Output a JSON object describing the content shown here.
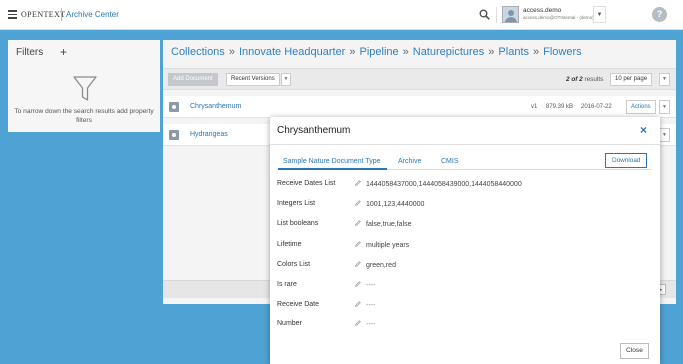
{
  "header": {
    "brand": "OPENTEXT",
    "app_name": "Archive Center",
    "user_name": "access.demo",
    "user_email": "access.demo@OTInternal - (demo)",
    "help_label": "?"
  },
  "filters": {
    "title": "Filters",
    "add_label": "+",
    "message": "To narrow down the search results add property filters"
  },
  "breadcrumb": [
    "Collections",
    "Innovate Headquarter",
    "Pipeline",
    "Naturepictures",
    "Plants",
    "Flowers"
  ],
  "breadcrumb_separator": "»",
  "toolbar": {
    "add_document": "Add Document",
    "recent_versions": "Recent Versions",
    "results_count": "2 of 2",
    "results_suffix": " results",
    "per_page": "10 per page"
  },
  "documents": [
    {
      "name": "Chrysanthemum",
      "version": "v1",
      "size": "879.39 kB",
      "date": "2016-07-22",
      "actions": "Actions"
    },
    {
      "name": "Hydrangeas"
    }
  ],
  "modal": {
    "title": "Chrysanthemum",
    "close_icon": "×",
    "tabs": [
      "Sample Nature Document Type",
      "Archive",
      "CMIS"
    ],
    "download": "Download",
    "properties": [
      {
        "label": "Receive Dates List",
        "value": "1444058437000,1444058439000,1444058440000"
      },
      {
        "label": "Integers List",
        "value": "1001,123,4440000"
      },
      {
        "label": "List booleans",
        "value": "false,true,false"
      },
      {
        "label": "Lifetime",
        "value": "multiple years"
      },
      {
        "label": "Colors List",
        "value": "green,red"
      },
      {
        "label": "Is rare",
        "value": "----"
      },
      {
        "label": "Receive Date",
        "value": "----"
      },
      {
        "label": "Number",
        "value": "----"
      }
    ],
    "close_button": "Close"
  },
  "colors": {
    "background": "#4fa3d4",
    "accent": "#2b77b3"
  },
  "icons": {
    "menu": "hamburger-icon",
    "search": "search-icon",
    "filter": "funnel-icon",
    "edit": "pencil-icon",
    "document": "image-document-icon"
  }
}
